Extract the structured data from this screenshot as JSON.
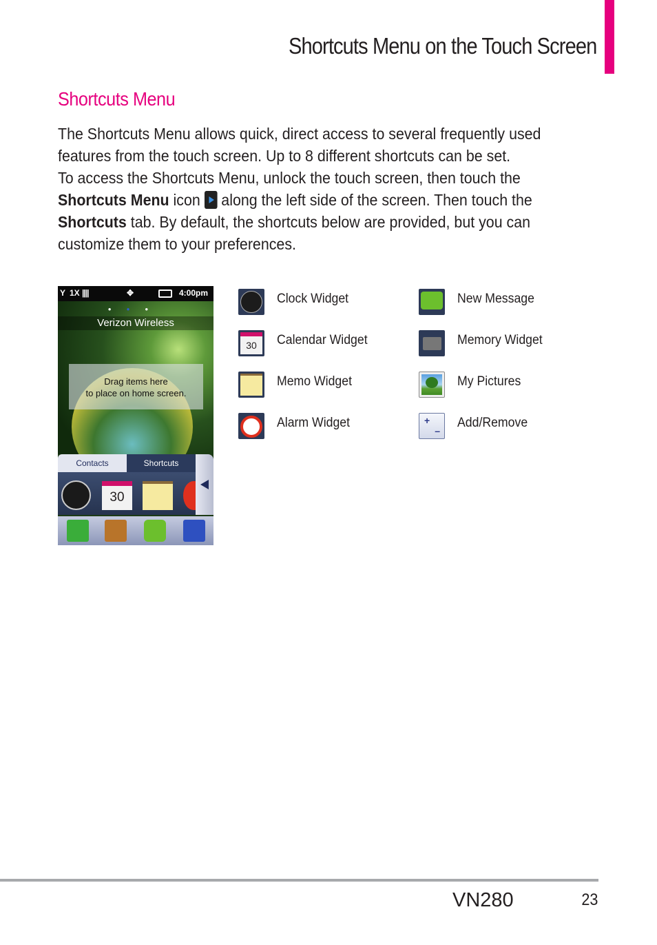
{
  "header": {
    "title": "Shortcuts Menu on the Touch Screen",
    "accent": "#e6007e"
  },
  "section": {
    "heading": "Shortcuts Menu"
  },
  "paragraph": {
    "l1": "The Shortcuts Menu allows quick, direct access to several frequently used",
    "l2": "features from the touch screen. Up to 8 different shortcuts can be set.",
    "l3": "To access the Shortcuts Menu, unlock the touch screen, then touch the",
    "l4_bold": "Shortcuts Menu",
    "l4_a": " icon ",
    "l4_b": " along the left side of the screen. Then touch the",
    "l5_bold": "Shortcuts",
    "l5_a": " tab. By default, the shortcuts below are provided, but you can",
    "l6": "customize them to your preferences.",
    "inline_icon": "shortcuts-menu-arrow-icon"
  },
  "phone": {
    "status": {
      "signal": "1X",
      "time": "4:00pm"
    },
    "carrier": "Verizon Wireless",
    "drag_line1": "Drag items here",
    "drag_line2": "to place on home screen.",
    "tabs": [
      "Contacts",
      "Shortcuts"
    ],
    "calendar_day": "30",
    "dock": [
      "phone-icon",
      "contacts-icon",
      "message-icon",
      "menu-icon"
    ]
  },
  "shortcuts": [
    {
      "label": "Clock Widget",
      "icon": "clock-icon"
    },
    {
      "label": "Calendar Widget",
      "icon": "calendar-icon",
      "day": "30"
    },
    {
      "label": "Memo Widget",
      "icon": "memo-icon"
    },
    {
      "label": "Alarm Widget",
      "icon": "alarm-icon"
    },
    {
      "label": "New Message",
      "icon": "message-icon"
    },
    {
      "label": "Memory Widget",
      "icon": "memory-card-icon"
    },
    {
      "label": "My Pictures",
      "icon": "picture-icon"
    },
    {
      "label": "Add/Remove",
      "icon": "add-remove-icon"
    }
  ],
  "footer": {
    "model": "VN280",
    "page": "23"
  }
}
